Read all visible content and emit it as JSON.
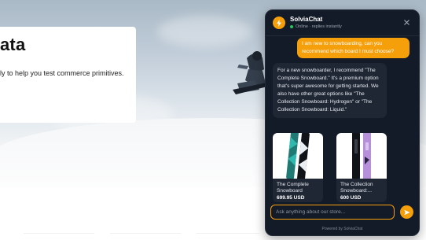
{
  "page": {
    "heading": "ata",
    "subtitle": "ly to help you test commerce primitives."
  },
  "chat": {
    "title": "SolviaChat",
    "status": "Online · replies instantly",
    "user_message": "I am new to snowboarding, can you recommend which board I must choose?",
    "bot_message": "For a new snowboarder, I recommend \"The Complete Snowboard.\" It's a premium option that's super awesome for getting started. We also have other great options like \"The Collection Snowboard: Hydrogen\" or \"The Collection Snowboard: Liquid.\"",
    "products": [
      {
        "name": "The Complete Snowboard",
        "price": "699.95 USD"
      },
      {
        "name": "The Collection Snowboard:...",
        "price": "600 USD"
      }
    ],
    "input_placeholder": "Ask anything about our store...",
    "powered_by": "Powered by SolviaChat"
  },
  "colors": {
    "accent": "#f59f0b",
    "panel": "#141b28",
    "bubble": "#1f2735",
    "online": "#22c55e"
  },
  "icons": {
    "brand": "lightning-bolt-icon",
    "close": "close-icon",
    "send": "send-arrow-icon"
  }
}
